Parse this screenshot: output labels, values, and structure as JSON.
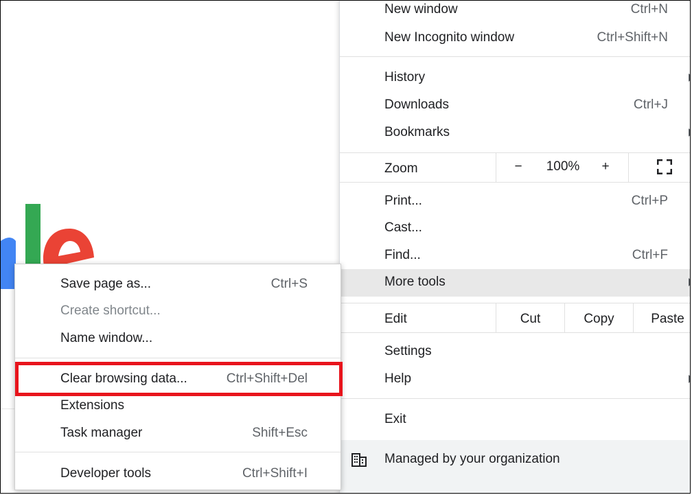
{
  "main_menu": {
    "new_window": {
      "label": "New window",
      "shortcut": "Ctrl+N"
    },
    "new_incognito": {
      "label": "New Incognito window",
      "shortcut": "Ctrl+Shift+N"
    },
    "history": {
      "label": "History"
    },
    "downloads": {
      "label": "Downloads",
      "shortcut": "Ctrl+J"
    },
    "bookmarks": {
      "label": "Bookmarks"
    },
    "zoom": {
      "label": "Zoom",
      "minus": "−",
      "level": "100%",
      "plus": "+"
    },
    "print": {
      "label": "Print...",
      "shortcut": "Ctrl+P"
    },
    "cast": {
      "label": "Cast..."
    },
    "find": {
      "label": "Find...",
      "shortcut": "Ctrl+F"
    },
    "more_tools": {
      "label": "More tools"
    },
    "edit": {
      "label": "Edit",
      "cut": "Cut",
      "copy": "Copy",
      "paste": "Paste"
    },
    "settings": {
      "label": "Settings"
    },
    "help": {
      "label": "Help"
    },
    "exit": {
      "label": "Exit"
    },
    "managed": {
      "label": "Managed by your organization",
      "icon": "building-icon"
    }
  },
  "sub_menu": {
    "save_page": {
      "label": "Save page as...",
      "shortcut": "Ctrl+S"
    },
    "create_shortcut": {
      "label": "Create shortcut..."
    },
    "name_window": {
      "label": "Name window..."
    },
    "clear_browsing": {
      "label": "Clear browsing data...",
      "shortcut": "Ctrl+Shift+Del"
    },
    "extensions": {
      "label": "Extensions"
    },
    "task_manager": {
      "label": "Task manager",
      "shortcut": "Shift+Esc"
    },
    "developer_tools": {
      "label": "Developer tools",
      "shortcut": "Ctrl+Shift+I"
    }
  },
  "colors": {
    "highlight_box": "#e8141c",
    "hover_row": "#e8e8e8",
    "logo_green": "#34a853",
    "logo_red": "#ea4335",
    "logo_blue": "#4285f4"
  }
}
